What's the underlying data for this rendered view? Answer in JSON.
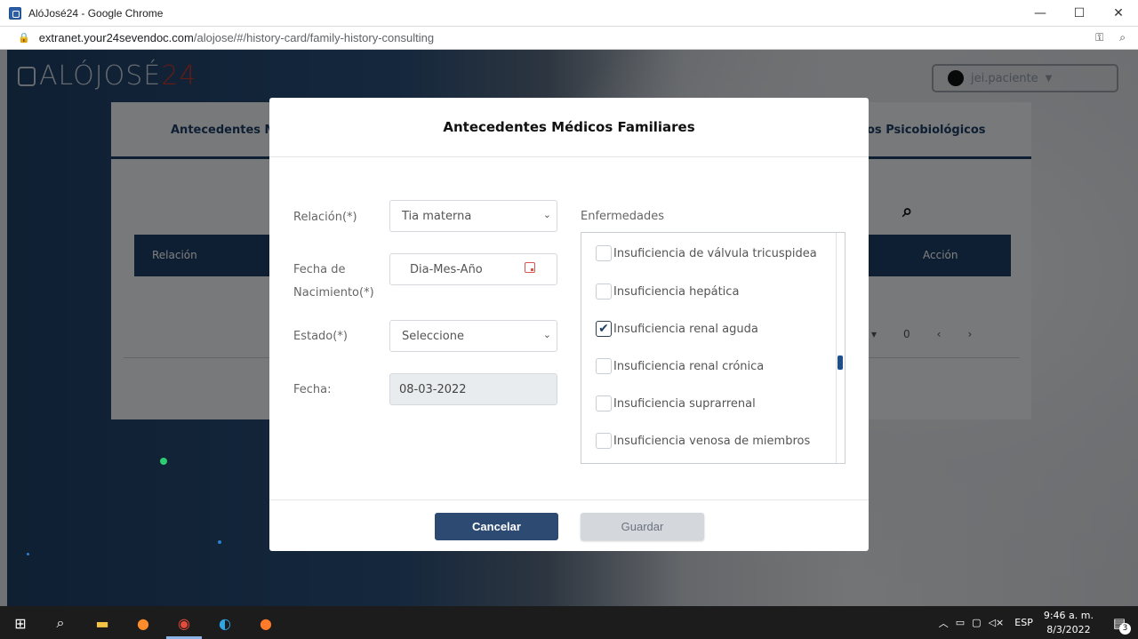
{
  "browser": {
    "window_title": "AlóJosé24 - Google Chrome",
    "url_host": "extranet.your24sevendoc.com",
    "url_path": "/alojose/#/history-card/family-history-consulting",
    "controls": {
      "minimize": "—",
      "maximize": "☐",
      "close": "✕"
    }
  },
  "app": {
    "logo_text": "ALÓJOSÉ",
    "logo_number": "24",
    "user_name": "jei.paciente"
  },
  "background_page": {
    "tab_left": "Antecedentes M",
    "tab_right": "os Psicobiológicos",
    "table_col_relation": "Relación",
    "table_col_action": "Acción",
    "pager_count": "0"
  },
  "modal": {
    "title": "Antecedentes Médicos Familiares",
    "relation_label": "Relación(*)",
    "relation_value": "Tia materna",
    "birth_label_line1": "Fecha de",
    "birth_label_line2": "Nacimiento(*)",
    "birth_placeholder": "Dia-Mes-Año",
    "state_label": "Estado(*)",
    "state_value": "Seleccione",
    "date_label": "Fecha:",
    "date_value": "08-03-2022",
    "diseases_label": "Enfermedades",
    "diseases": [
      {
        "label": "Insuficiencia de válvula tricuspidea",
        "checked": false
      },
      {
        "label": "Insuficiencia hepática",
        "checked": false
      },
      {
        "label": "Insuficiencia renal aguda",
        "checked": true
      },
      {
        "label": "Insuficiencia renal crónica",
        "checked": false
      },
      {
        "label": "Insuficiencia suprarrenal",
        "checked": false
      },
      {
        "label": "Insuficiencia venosa de miembros",
        "checked": false
      }
    ],
    "cancel_label": "Cancelar",
    "save_label": "Guardar"
  },
  "taskbar": {
    "language": "ESP",
    "time": "9:46 a. m.",
    "date": "8/3/2022",
    "notifications": "3"
  }
}
